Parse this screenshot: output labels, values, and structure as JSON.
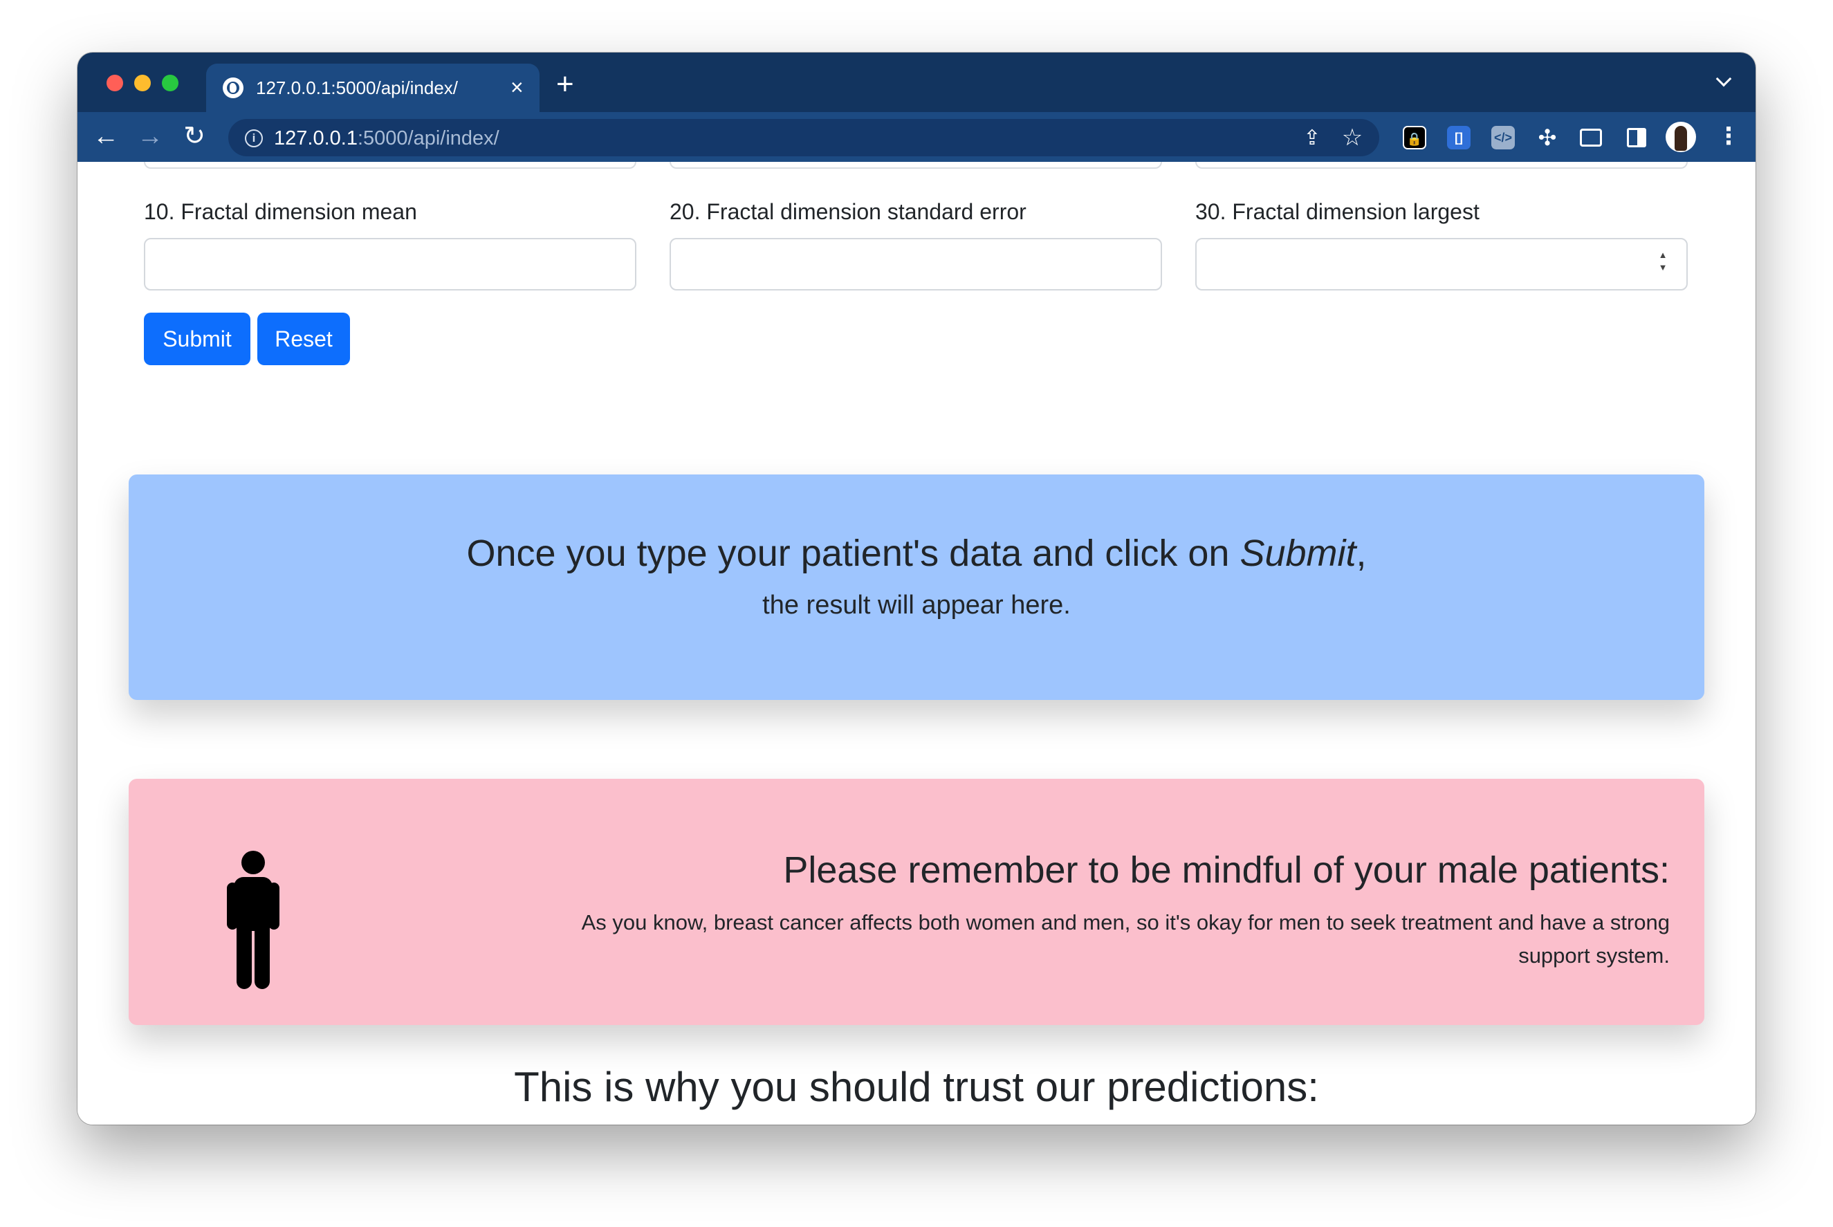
{
  "browser": {
    "tab_title": "127.0.0.1:5000/api/index/",
    "tab_close": "×",
    "new_tab": "+",
    "url_host": "127.0.0.1",
    "url_rest": ":5000/api/index/"
  },
  "form": {
    "fields": [
      {
        "label": "10. Fractal dimension mean",
        "value": ""
      },
      {
        "label": "20. Fractal dimension standard error",
        "value": ""
      },
      {
        "label": "30. Fractal dimension largest",
        "value": ""
      }
    ],
    "submit_label": "Submit",
    "reset_label": "Reset"
  },
  "result": {
    "title_prefix": "Once you type your patient's data and click on ",
    "title_em": "Submit",
    "title_suffix": ",",
    "subtitle": "the result will appear here."
  },
  "notice": {
    "icon": "male-person-icon",
    "title": "Please remember to be mindful of your male patients:",
    "text": "As you know, breast cancer affects both women and men, so it's okay for men to seek treatment and have a strong support system."
  },
  "trust": {
    "heading": "This is why you should trust our predictions:"
  },
  "colors": {
    "tabbar": "#12345f",
    "toolbar": "#1c4a82",
    "button": "#0d6efd",
    "result_bg": "#9ec5fe",
    "notice_bg": "#fbbfcc"
  }
}
